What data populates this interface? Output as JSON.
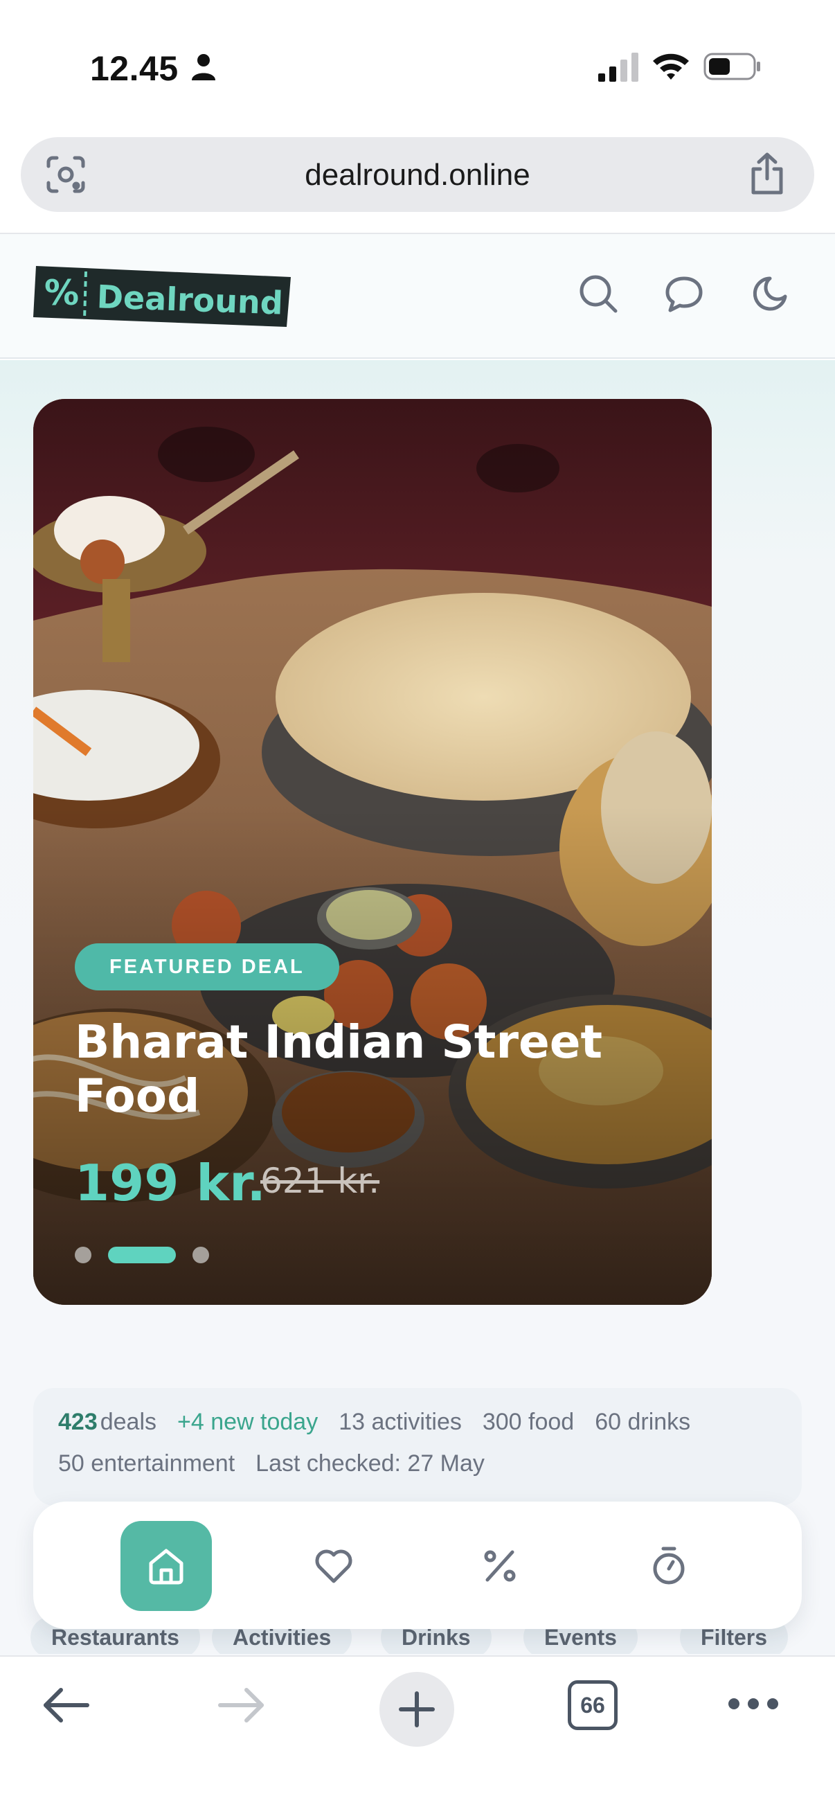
{
  "status_bar": {
    "time": "12.45"
  },
  "browser": {
    "url": "dealround.online",
    "tab_count": "66"
  },
  "site": {
    "logo_text": "Dealround",
    "logo_symbol": "%"
  },
  "featured": {
    "badge": "FEATURED DEAL",
    "title": "Bharat Indian Street Food",
    "price": "199 kr.",
    "old_price": "621 kr.",
    "slide_count": 3,
    "active_slide": 2
  },
  "stats": {
    "deals_count": "423",
    "deals_label": "deals",
    "new_today": "+4 new today",
    "activities": "13 activities",
    "food": "300 food",
    "drinks": "60 drinks",
    "entertainment": "50 entertainment",
    "last_checked": "Last checked: 27 May"
  },
  "categories": [
    "Restaurants",
    "Activities",
    "Drinks",
    "Events",
    "Filters"
  ],
  "bottom_nav": [
    "home-icon",
    "heart-icon",
    "percent-icon",
    "timer-icon"
  ],
  "colors": {
    "accent": "#55b9a5",
    "price": "#5fd3bf",
    "logo_bg": "#1f2a2a",
    "logo_text": "#6fd6c0"
  }
}
